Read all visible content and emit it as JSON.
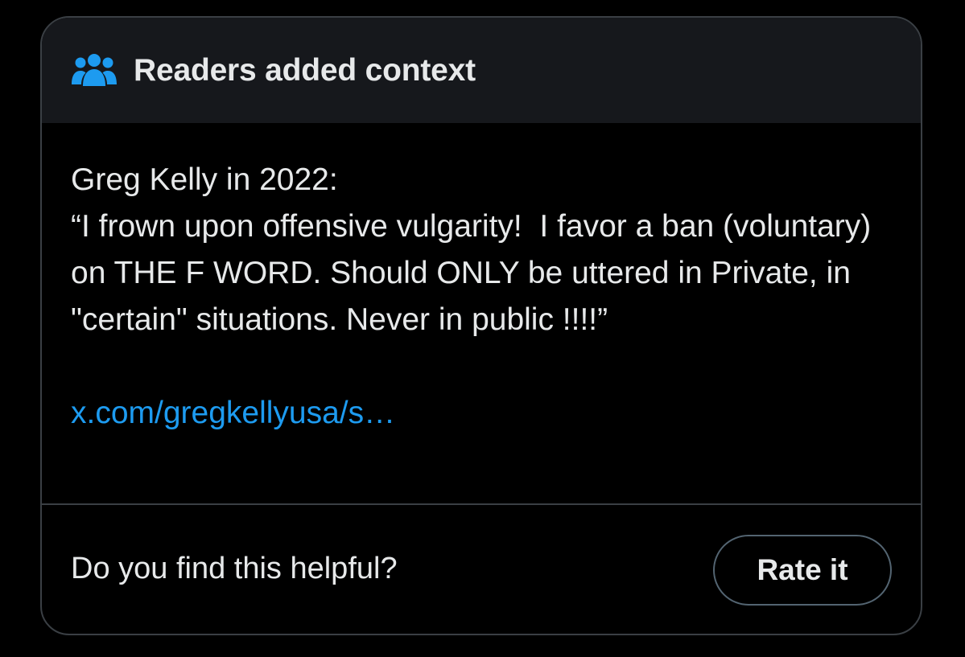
{
  "header": {
    "icon": "people-group-icon",
    "title": "Readers added context",
    "icon_color": "#1d9bf0"
  },
  "note": {
    "text": "Greg Kelly in 2022:\n“I frown upon offensive vulgarity!  I favor a ban (voluntary) on THE F WORD. Should ONLY be uttered in Private, in \"certain\" situations. Never in public !!!!”",
    "link_text": "x.com/gregkellyusa/s…"
  },
  "footer": {
    "question": "Do you find this helpful?",
    "rate_label": "Rate it"
  },
  "colors": {
    "background": "#000000",
    "header_bg": "#16181c",
    "text": "#e7e9ea",
    "link": "#1d9bf0",
    "border": "#3a3f44"
  }
}
